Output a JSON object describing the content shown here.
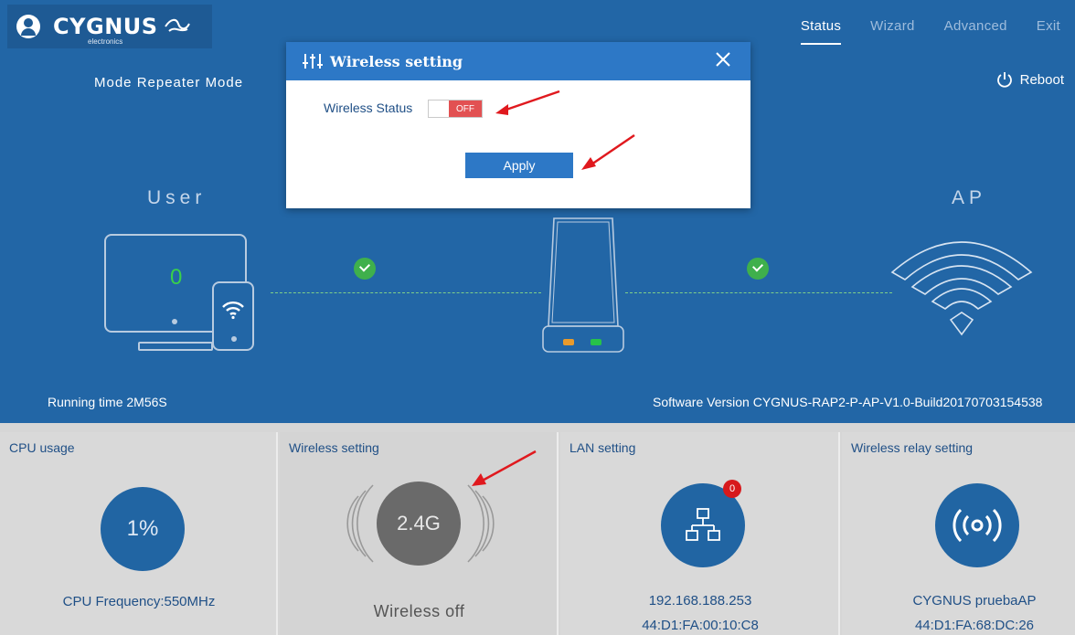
{
  "header": {
    "brand": "CYGNUS",
    "brand_sub": "electronics",
    "nav": [
      "Status",
      "Wizard",
      "Advanced",
      "Exit"
    ],
    "active_nav": "Status"
  },
  "hero": {
    "mode": "Mode  Repeater Mode",
    "reboot": "Reboot",
    "user_label": "User",
    "ap_label": "AP",
    "user_count": "0",
    "running_time": "Running time  2M56S",
    "software_version": "Software Version  CYGNUS-RAP2-P-AP-V1.0-Build20170703154538"
  },
  "modal": {
    "title": "Wireless setting",
    "status_label": "Wireless Status",
    "toggle_value": "OFF",
    "apply": "Apply"
  },
  "panels": {
    "cpu": {
      "title": "CPU usage",
      "usage": "1%",
      "frequency": "CPU Frequency:550MHz"
    },
    "wireless": {
      "title": "Wireless setting",
      "band": "2.4G",
      "status": "Wireless off"
    },
    "lan": {
      "title": "LAN setting",
      "badge": "0",
      "ip": "192.168.188.253",
      "mac": "44:D1:FA:00:10:C8"
    },
    "relay": {
      "title": "Wireless relay setting",
      "ssid": "CYGNUS pruebaAP",
      "mac": "44:D1:FA:68:DC:26"
    }
  },
  "colors": {
    "hero_bg": "#2266a6",
    "accent": "#2d78c6",
    "toggle_off": "#e25152",
    "status_ok": "#3fb04c",
    "annotation_arrow": "#e0191e"
  },
  "icons": [
    "user-icon",
    "power-icon",
    "wireless-setting-icon",
    "close-icon",
    "wifi-icon",
    "check-icon",
    "network-icon",
    "broadcast-icon"
  ]
}
